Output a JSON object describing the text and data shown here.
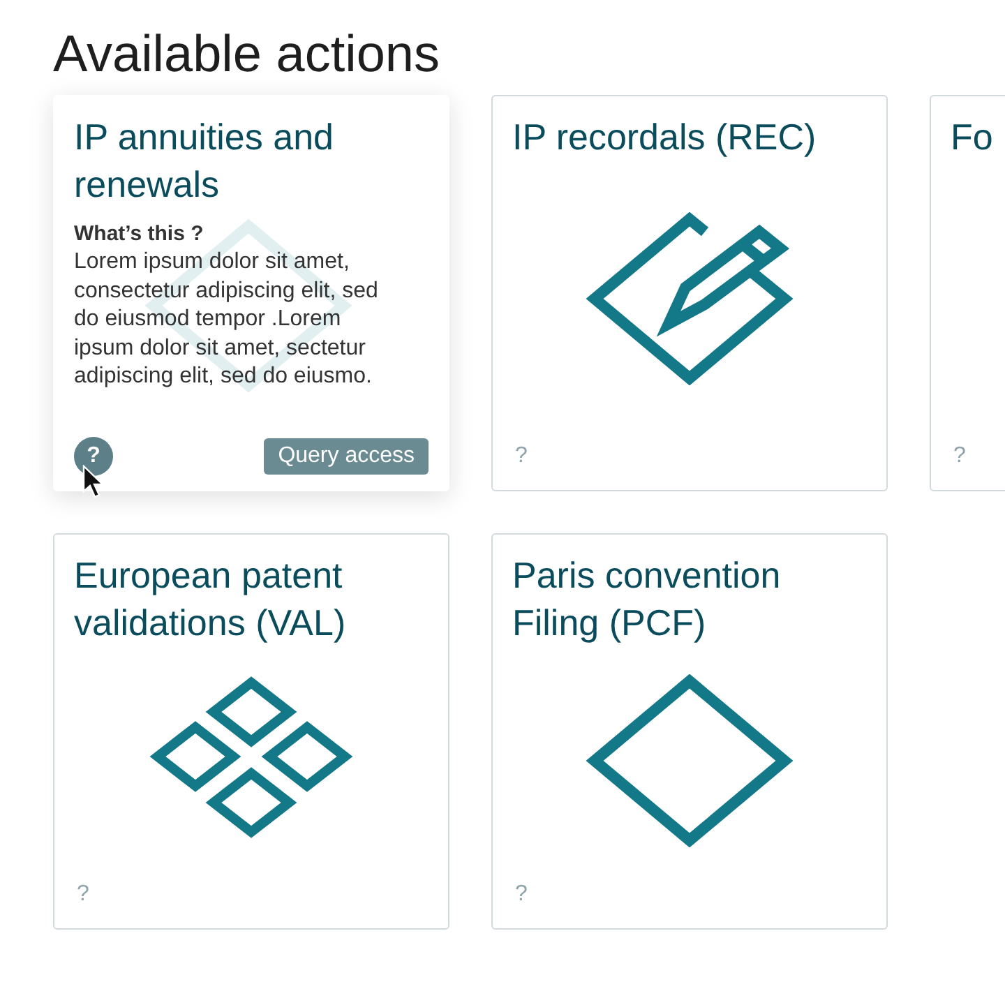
{
  "heading": "Available actions",
  "cards": [
    {
      "title": "IP annuities and renewals",
      "kind": "diamond",
      "expanded": true,
      "help_title": "What’s this ?",
      "help_text": "Lorem ipsum dolor sit amet, consectetur adipiscing elit, sed do eiusmod tempor .Lorem ipsum dolor sit amet, sectetur adipiscing elit, sed do eiusmo.",
      "button": "Query access",
      "help": "?"
    },
    {
      "title": "IP recordals (REC)",
      "kind": "pencil",
      "expanded": false,
      "help": "?"
    },
    {
      "title": "Fo",
      "expanded": false,
      "help": "?"
    },
    {
      "title": "European patent validations (VAL)",
      "kind": "grid",
      "expanded": false,
      "help": "?"
    },
    {
      "title": "Paris convention Filing (PCF)",
      "kind": "diamond",
      "expanded": false,
      "help": "?"
    }
  ]
}
